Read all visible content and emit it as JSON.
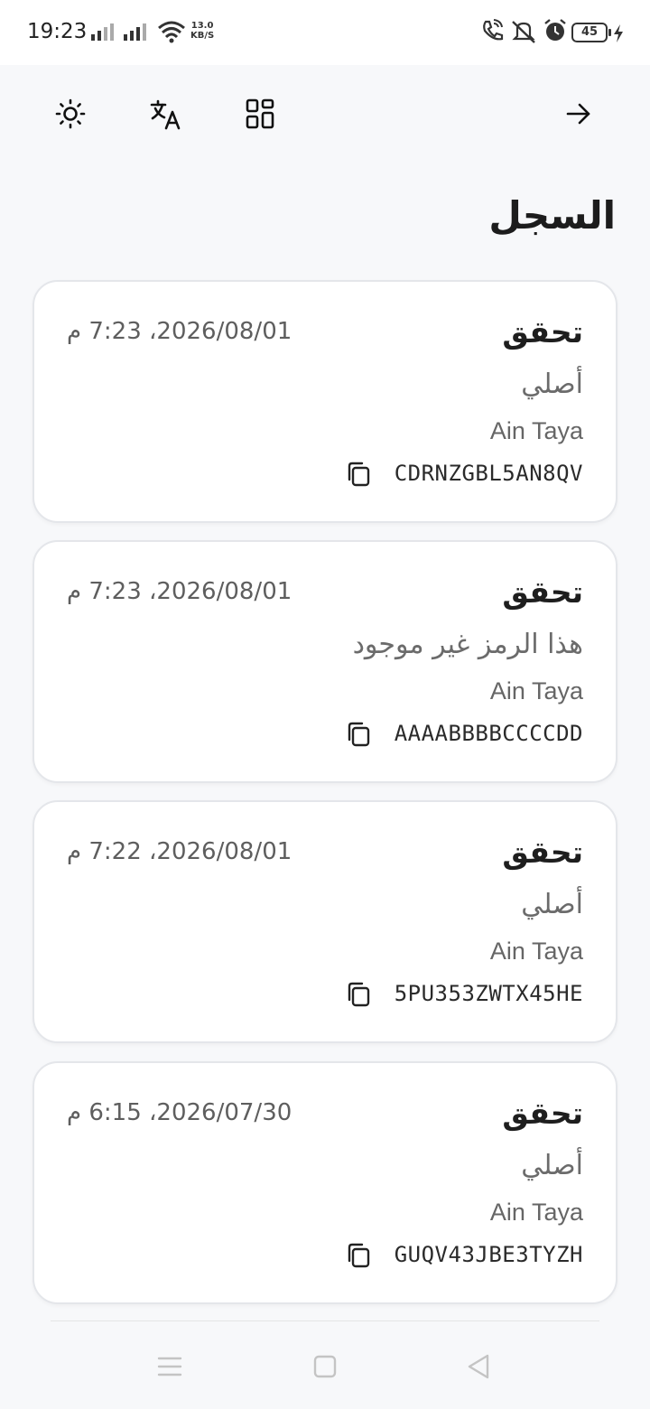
{
  "status_bar": {
    "time": "19:23",
    "net_speed_value": "13.0",
    "net_speed_unit": "KB/S",
    "battery": "45"
  },
  "toolbar": {
    "icons": [
      "brightness-icon",
      "translate-icon",
      "grid-icon",
      "arrow-right-icon"
    ]
  },
  "page": {
    "title": "السجل"
  },
  "history": [
    {
      "title": "تحقق",
      "datetime": "2026/08/01، 7:23 م",
      "status": "أصلي",
      "location": "Ain Taya",
      "code": "CDRNZGBL5AN8QV"
    },
    {
      "title": "تحقق",
      "datetime": "2026/08/01، 7:23 م",
      "status": "هذا الرمز غير موجود",
      "location": "Ain Taya",
      "code": "AAAABBBBCCCCDD"
    },
    {
      "title": "تحقق",
      "datetime": "2026/08/01، 7:22 م",
      "status": "أصلي",
      "location": "Ain Taya",
      "code": "5PU353ZWTX45HE"
    },
    {
      "title": "تحقق",
      "datetime": "2026/07/30، 6:15 م",
      "status": "أصلي",
      "location": "Ain Taya",
      "code": "GUQV43JBE3TYZH"
    }
  ],
  "colors": {
    "background": "#f7f8fa",
    "card": "#ffffff",
    "border": "#e4e6ea"
  }
}
